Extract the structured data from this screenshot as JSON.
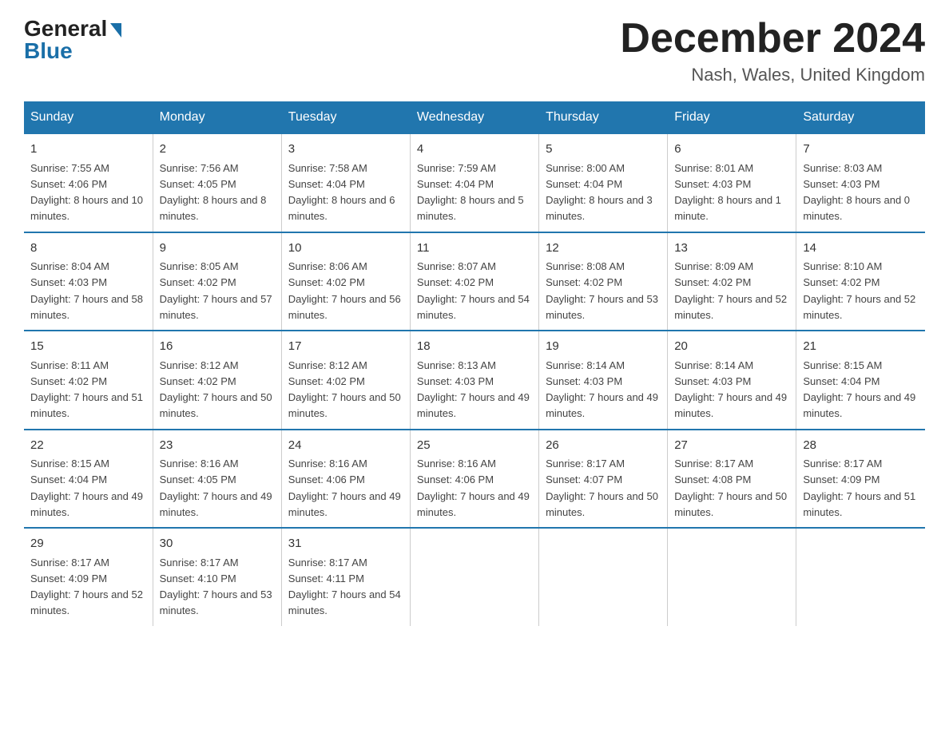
{
  "header": {
    "logo_general": "General",
    "logo_blue": "Blue",
    "month_title": "December 2024",
    "location": "Nash, Wales, United Kingdom"
  },
  "days_of_week": [
    "Sunday",
    "Monday",
    "Tuesday",
    "Wednesday",
    "Thursday",
    "Friday",
    "Saturday"
  ],
  "weeks": [
    [
      {
        "day": "1",
        "sunrise": "7:55 AM",
        "sunset": "4:06 PM",
        "daylight": "8 hours and 10 minutes."
      },
      {
        "day": "2",
        "sunrise": "7:56 AM",
        "sunset": "4:05 PM",
        "daylight": "8 hours and 8 minutes."
      },
      {
        "day": "3",
        "sunrise": "7:58 AM",
        "sunset": "4:04 PM",
        "daylight": "8 hours and 6 minutes."
      },
      {
        "day": "4",
        "sunrise": "7:59 AM",
        "sunset": "4:04 PM",
        "daylight": "8 hours and 5 minutes."
      },
      {
        "day": "5",
        "sunrise": "8:00 AM",
        "sunset": "4:04 PM",
        "daylight": "8 hours and 3 minutes."
      },
      {
        "day": "6",
        "sunrise": "8:01 AM",
        "sunset": "4:03 PM",
        "daylight": "8 hours and 1 minute."
      },
      {
        "day": "7",
        "sunrise": "8:03 AM",
        "sunset": "4:03 PM",
        "daylight": "8 hours and 0 minutes."
      }
    ],
    [
      {
        "day": "8",
        "sunrise": "8:04 AM",
        "sunset": "4:03 PM",
        "daylight": "7 hours and 58 minutes."
      },
      {
        "day": "9",
        "sunrise": "8:05 AM",
        "sunset": "4:02 PM",
        "daylight": "7 hours and 57 minutes."
      },
      {
        "day": "10",
        "sunrise": "8:06 AM",
        "sunset": "4:02 PM",
        "daylight": "7 hours and 56 minutes."
      },
      {
        "day": "11",
        "sunrise": "8:07 AM",
        "sunset": "4:02 PM",
        "daylight": "7 hours and 54 minutes."
      },
      {
        "day": "12",
        "sunrise": "8:08 AM",
        "sunset": "4:02 PM",
        "daylight": "7 hours and 53 minutes."
      },
      {
        "day": "13",
        "sunrise": "8:09 AM",
        "sunset": "4:02 PM",
        "daylight": "7 hours and 52 minutes."
      },
      {
        "day": "14",
        "sunrise": "8:10 AM",
        "sunset": "4:02 PM",
        "daylight": "7 hours and 52 minutes."
      }
    ],
    [
      {
        "day": "15",
        "sunrise": "8:11 AM",
        "sunset": "4:02 PM",
        "daylight": "7 hours and 51 minutes."
      },
      {
        "day": "16",
        "sunrise": "8:12 AM",
        "sunset": "4:02 PM",
        "daylight": "7 hours and 50 minutes."
      },
      {
        "day": "17",
        "sunrise": "8:12 AM",
        "sunset": "4:02 PM",
        "daylight": "7 hours and 50 minutes."
      },
      {
        "day": "18",
        "sunrise": "8:13 AM",
        "sunset": "4:03 PM",
        "daylight": "7 hours and 49 minutes."
      },
      {
        "day": "19",
        "sunrise": "8:14 AM",
        "sunset": "4:03 PM",
        "daylight": "7 hours and 49 minutes."
      },
      {
        "day": "20",
        "sunrise": "8:14 AM",
        "sunset": "4:03 PM",
        "daylight": "7 hours and 49 minutes."
      },
      {
        "day": "21",
        "sunrise": "8:15 AM",
        "sunset": "4:04 PM",
        "daylight": "7 hours and 49 minutes."
      }
    ],
    [
      {
        "day": "22",
        "sunrise": "8:15 AM",
        "sunset": "4:04 PM",
        "daylight": "7 hours and 49 minutes."
      },
      {
        "day": "23",
        "sunrise": "8:16 AM",
        "sunset": "4:05 PM",
        "daylight": "7 hours and 49 minutes."
      },
      {
        "day": "24",
        "sunrise": "8:16 AM",
        "sunset": "4:06 PM",
        "daylight": "7 hours and 49 minutes."
      },
      {
        "day": "25",
        "sunrise": "8:16 AM",
        "sunset": "4:06 PM",
        "daylight": "7 hours and 49 minutes."
      },
      {
        "day": "26",
        "sunrise": "8:17 AM",
        "sunset": "4:07 PM",
        "daylight": "7 hours and 50 minutes."
      },
      {
        "day": "27",
        "sunrise": "8:17 AM",
        "sunset": "4:08 PM",
        "daylight": "7 hours and 50 minutes."
      },
      {
        "day": "28",
        "sunrise": "8:17 AM",
        "sunset": "4:09 PM",
        "daylight": "7 hours and 51 minutes."
      }
    ],
    [
      {
        "day": "29",
        "sunrise": "8:17 AM",
        "sunset": "4:09 PM",
        "daylight": "7 hours and 52 minutes."
      },
      {
        "day": "30",
        "sunrise": "8:17 AM",
        "sunset": "4:10 PM",
        "daylight": "7 hours and 53 minutes."
      },
      {
        "day": "31",
        "sunrise": "8:17 AM",
        "sunset": "4:11 PM",
        "daylight": "7 hours and 54 minutes."
      },
      {
        "day": "",
        "sunrise": "",
        "sunset": "",
        "daylight": ""
      },
      {
        "day": "",
        "sunrise": "",
        "sunset": "",
        "daylight": ""
      },
      {
        "day": "",
        "sunrise": "",
        "sunset": "",
        "daylight": ""
      },
      {
        "day": "",
        "sunrise": "",
        "sunset": "",
        "daylight": ""
      }
    ]
  ],
  "labels": {
    "sunrise": "Sunrise: ",
    "sunset": "Sunset: ",
    "daylight": "Daylight: "
  }
}
